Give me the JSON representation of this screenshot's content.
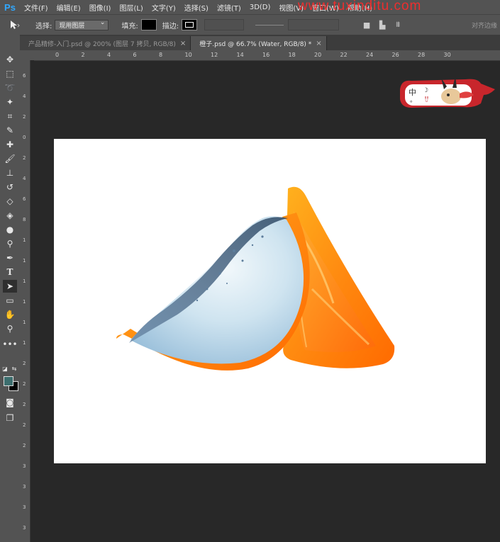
{
  "app": {
    "logo": "Ps",
    "watermark": "www.tuxinditu.com"
  },
  "menu": [
    "文件(F)",
    "编辑(E)",
    "图像(I)",
    "图层(L)",
    "文字(Y)",
    "选择(S)",
    "滤镜(T)",
    "3D(D)",
    "视图(V)",
    "窗口(W)",
    "帮助(H)"
  ],
  "options": {
    "select_label": "选择:",
    "select_value": "现用图层",
    "fill_label": "填充:",
    "stroke_label": "描边:",
    "right_label": "对齐边缘"
  },
  "tabs": [
    {
      "label": "产品精修-入门.psd @ 200% (图层 7 拷贝, RGB/8)",
      "close": "×"
    },
    {
      "label": "橙子.psd @ 66.7% (Water, RGB/8) *",
      "close": "×"
    }
  ],
  "ruler": {
    "top": [
      "0",
      "2",
      "4",
      "6",
      "8",
      "10",
      "12",
      "14",
      "16",
      "18",
      "20",
      "22",
      "24",
      "26",
      "28",
      "30"
    ],
    "left": [
      "6",
      "4",
      "2",
      "0",
      "2",
      "4",
      "6",
      "8",
      "1",
      "1",
      "1",
      "1",
      "1",
      "1",
      "2",
      "2",
      "2",
      "2",
      "2",
      "3",
      "3",
      "3",
      "3"
    ]
  },
  "tools": [
    "move-tool-icon",
    "marquee-tool-icon",
    "lasso-tool-icon",
    "magic-wand-tool-icon",
    "crop-tool-icon",
    "eyedropper-tool-icon",
    "healing-brush-tool-icon",
    "brush-tool-icon",
    "clone-stamp-tool-icon",
    "history-brush-tool-icon",
    "eraser-tool-icon",
    "paint-bucket-tool-icon",
    "blur-tool-icon",
    "dodge-tool-icon",
    "pen-tool-icon",
    "type-tool-icon",
    "path-selection-tool-icon",
    "rectangle-tool-icon",
    "hand-tool-icon",
    "zoom-tool-icon",
    "more-tools-icon"
  ],
  "type_tool_glyph": "T",
  "colors": {
    "foreground": "#3c6e6e",
    "background": "#000000",
    "accent": "#31a8ff"
  }
}
